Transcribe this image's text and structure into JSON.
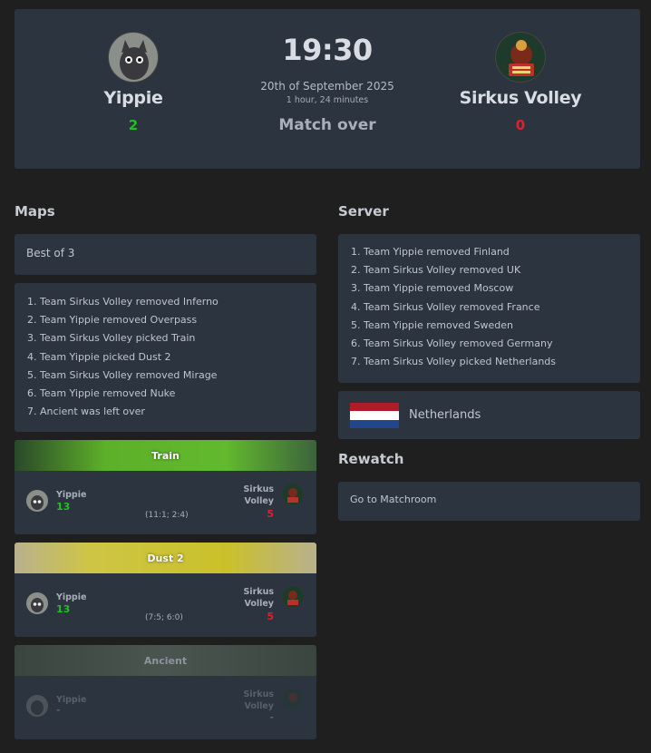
{
  "match": {
    "team1": {
      "name": "Yippie",
      "score": "2"
    },
    "team2": {
      "name": "Sirkus Volley",
      "score": "0"
    },
    "time": "19:30",
    "date": "20th of September 2025",
    "duration": "1 hour, 24 minutes",
    "status": "Match over"
  },
  "maps": {
    "title": "Maps",
    "format": "Best of 3",
    "veto": [
      "1. Team Sirkus Volley removed Inferno",
      "2. Team Yippie removed Overpass",
      "3. Team Sirkus Volley picked Train",
      "4. Team Yippie picked Dust 2",
      "5. Team Sirkus Volley removed Mirage",
      "6. Team Yippie removed Nuke",
      "7. Ancient was left over"
    ],
    "results": [
      {
        "map": "Train",
        "team1": "Yippie",
        "team2_line1": "Sirkus",
        "team2_line2": "Volley",
        "score1": "13",
        "score2": "5",
        "detail": "(11:1; 2:4)"
      },
      {
        "map": "Dust 2",
        "team1": "Yippie",
        "team2_line1": "Sirkus",
        "team2_line2": "Volley",
        "score1": "13",
        "score2": "5",
        "detail": "(7:5; 6:0)"
      },
      {
        "map": "Ancient",
        "team1": "Yippie",
        "team2_line1": "Sirkus",
        "team2_line2": "Volley",
        "score1": "-",
        "score2": "-",
        "detail": ""
      }
    ]
  },
  "server": {
    "title": "Server",
    "veto": [
      "1. Team Yippie removed Finland",
      "2. Team Sirkus Volley removed UK",
      "3. Team Yippie removed Moscow",
      "4. Team Sirkus Volley removed France",
      "5. Team Yippie removed Sweden",
      "6. Team Sirkus Volley removed Germany",
      "7. Team Sirkus Volley picked Netherlands"
    ],
    "selected": "Netherlands",
    "flag_colors": [
      "#ae1c28",
      "#ffffff",
      "#21468b"
    ]
  },
  "rewatch": {
    "title": "Rewatch",
    "link": "Go to Matchroom"
  },
  "colors": {
    "win": "#1fc21f",
    "loss": "#e0202a",
    "card": "#2c3440",
    "background": "#1f1f1f"
  }
}
